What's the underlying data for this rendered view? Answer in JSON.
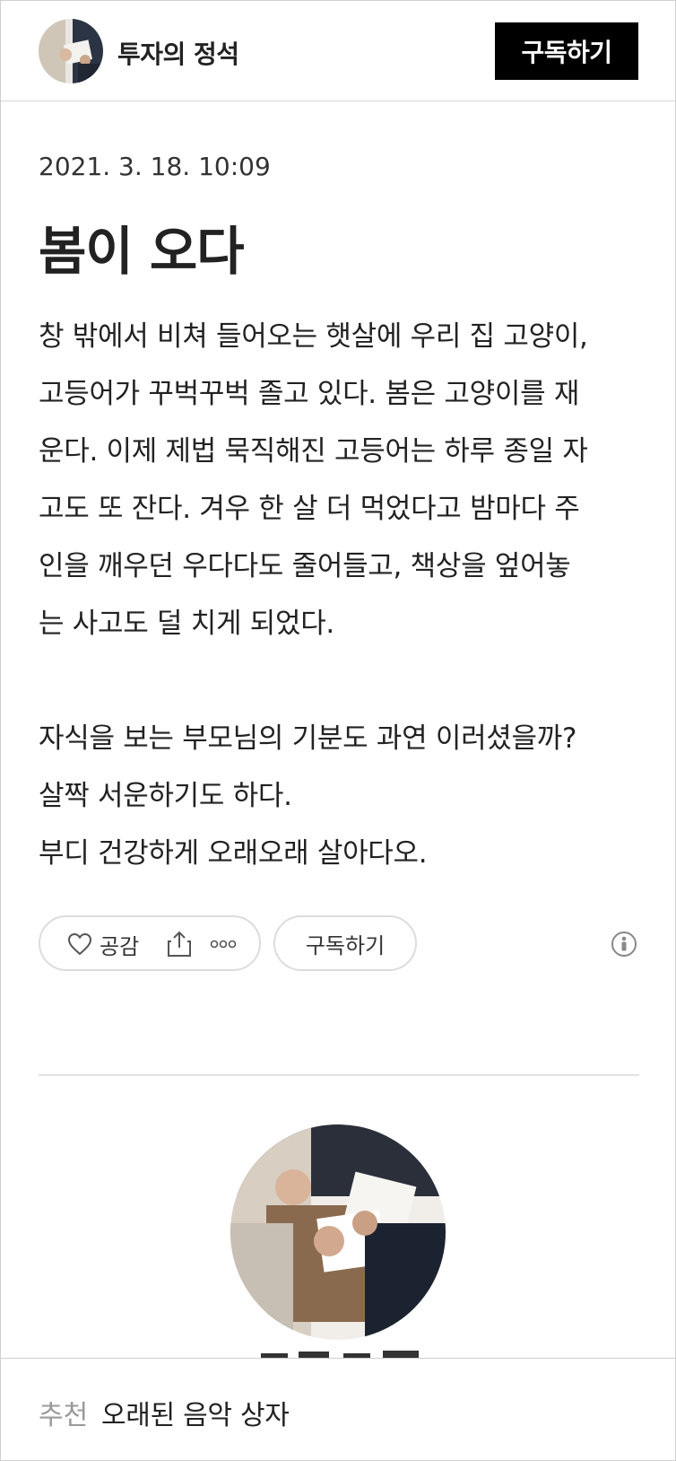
{
  "header": {
    "blog_name": "투자의 정석",
    "subscribe_label": "구독하기"
  },
  "post": {
    "date": "2021. 3. 18. 10:09",
    "title": "봄이 오다",
    "paragraph1": [
      "창 밖에서 비쳐 들어오는 햇살에 우리 집 고양이,",
      "고등어가 꾸벅꾸벅 졸고 있다. 봄은 고양이를 재",
      "운다. 이제 제법 묵직해진 고등어는 하루 종일 자",
      "고도 또 잔다. 겨우 한 살 더 먹었다고 밤마다 주",
      "인을 깨우던 우다다도 줄어들고, 책상을 엎어놓",
      "는 사고도 덜 치게 되었다."
    ],
    "paragraph2": [
      "자식을 보는 부모님의 기분도 과연 이러셨을까?",
      "살짝 서운하기도 하다.",
      "부디 건강하게 오래오래 살아다오."
    ]
  },
  "actions": {
    "like_label": "공감",
    "subscribe_label": "구독하기",
    "icons": {
      "like": "heart-outline-icon",
      "share": "share-icon",
      "more": "more-dots-icon",
      "info": "info-icon"
    }
  },
  "recommendation": {
    "label": "추천",
    "title": "오래된 음악 상자"
  }
}
